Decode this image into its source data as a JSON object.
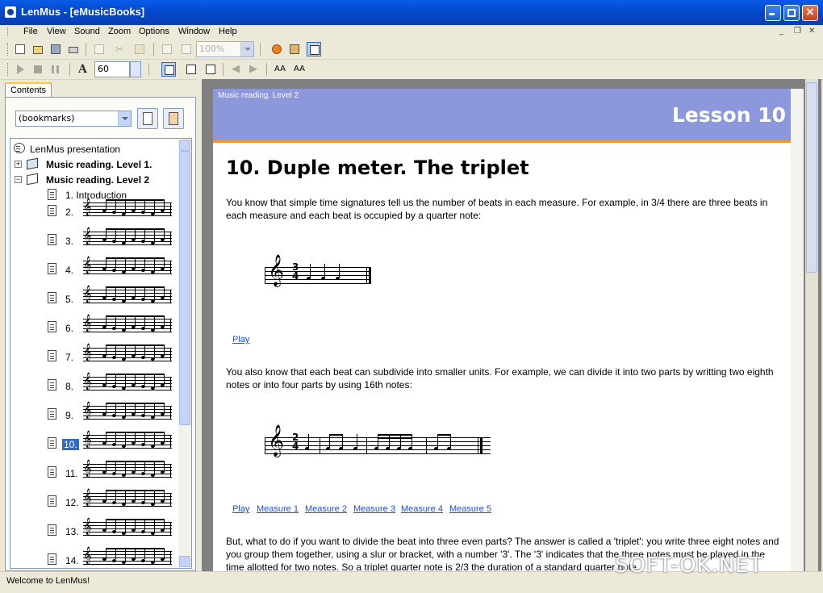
{
  "window": {
    "title": "LenMus - [eMusicBooks]"
  },
  "menu": [
    "File",
    "View",
    "Sound",
    "Zoom",
    "Options",
    "Window",
    "Help"
  ],
  "toolbar": {
    "zoom_value": "100%",
    "tempo_value": "60",
    "font_larger": "AA",
    "font_smaller": "AA"
  },
  "left_panel": {
    "tab": "Contents",
    "bookmarks_select": "(bookmarks)",
    "tree": [
      {
        "label": "LenMus presentation"
      },
      {
        "label": "Music reading. Level 1."
      },
      {
        "label": "Music reading. Level 2"
      },
      {
        "label": "1. Introduction"
      },
      {
        "label": "2."
      },
      {
        "label": "3."
      },
      {
        "label": "4."
      },
      {
        "label": "5."
      },
      {
        "label": "6."
      },
      {
        "label": "7."
      },
      {
        "label": "8."
      },
      {
        "label": "9."
      },
      {
        "label": "10."
      },
      {
        "label": "11."
      },
      {
        "label": "12."
      },
      {
        "label": "13."
      },
      {
        "label": "14."
      }
    ]
  },
  "document": {
    "breadcrumb": "Music reading. Level 2",
    "lesson": "Lesson 10",
    "heading": "10. Duple meter. The triplet",
    "para1": "You know that simple time signatures tell us the number of beats in each measure. For example, in 3/4 there are three beats in each measure and each beat is occupied by a quarter note:",
    "ex1": {
      "time_top": "3",
      "time_bottom": "4",
      "play": "Play"
    },
    "para2": "You also know that each beat can subdivide into smaller units. For example, we can divide it into two parts by writting two eighth notes or into four parts by using 16th notes:",
    "ex2": {
      "time_top": "2",
      "time_bottom": "4"
    },
    "links2": [
      "Play",
      "Measure 1",
      "Measure 2",
      "Measure 3",
      "Measure 4",
      "Measure 5"
    ],
    "para3": "But, what to do if you want to divide the beat into three even parts? The answer is called a 'triplet': you write three eight notes and you group them together, using a slur or bracket, with a number '3'. The '3' indicates that the three notes must be played in the time allotted for two notes. So a triplet quarter note is 2/3 the duration of a standard quarter note."
  },
  "status": "Welcome to LenMus!",
  "watermark": "SOFT-OK.NET",
  "colors": {
    "banner": "#8c97dc",
    "banner_rule": "#f39a2b",
    "link": "#1f4fd6",
    "selection": "#316ac5"
  }
}
